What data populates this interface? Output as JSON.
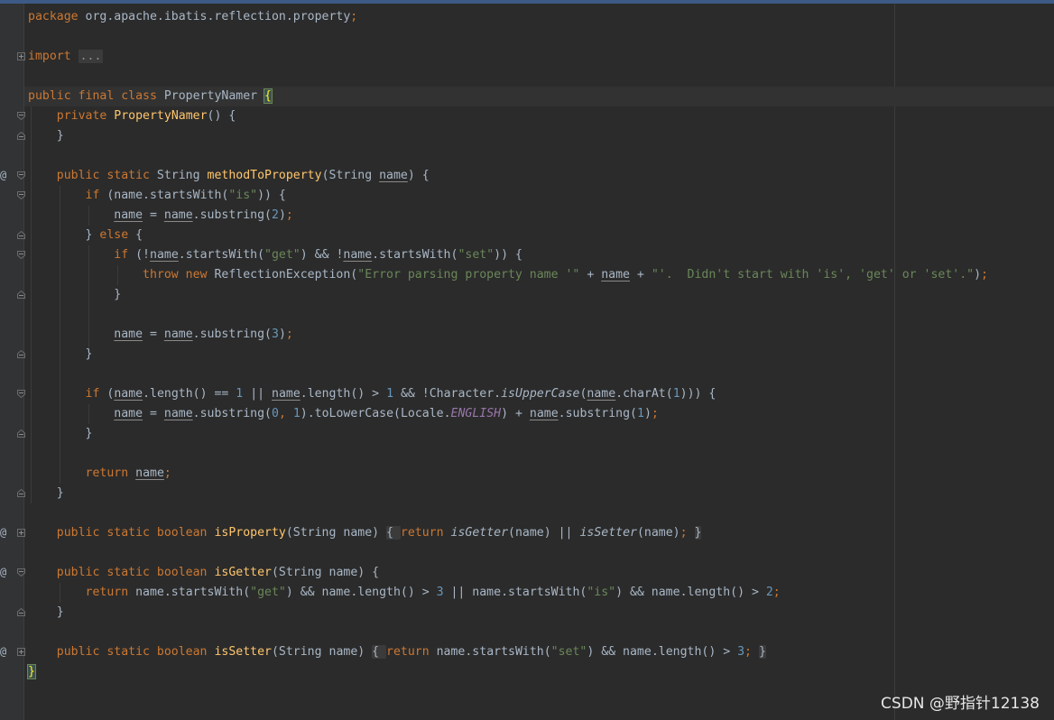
{
  "editor": {
    "language": "Java",
    "colors": {
      "background": "#2b2b2b",
      "gutter": "#313335",
      "keyword": "#cc7832",
      "function": "#ffc66d",
      "string": "#6a8759",
      "number": "#6897bb",
      "constant": "#9876aa",
      "text": "#a9b7c6"
    },
    "gutter_icons": [
      "fold-icon",
      "override-at-icon"
    ],
    "caret_line": 5
  },
  "watermark": "CSDN @野指针12138"
}
